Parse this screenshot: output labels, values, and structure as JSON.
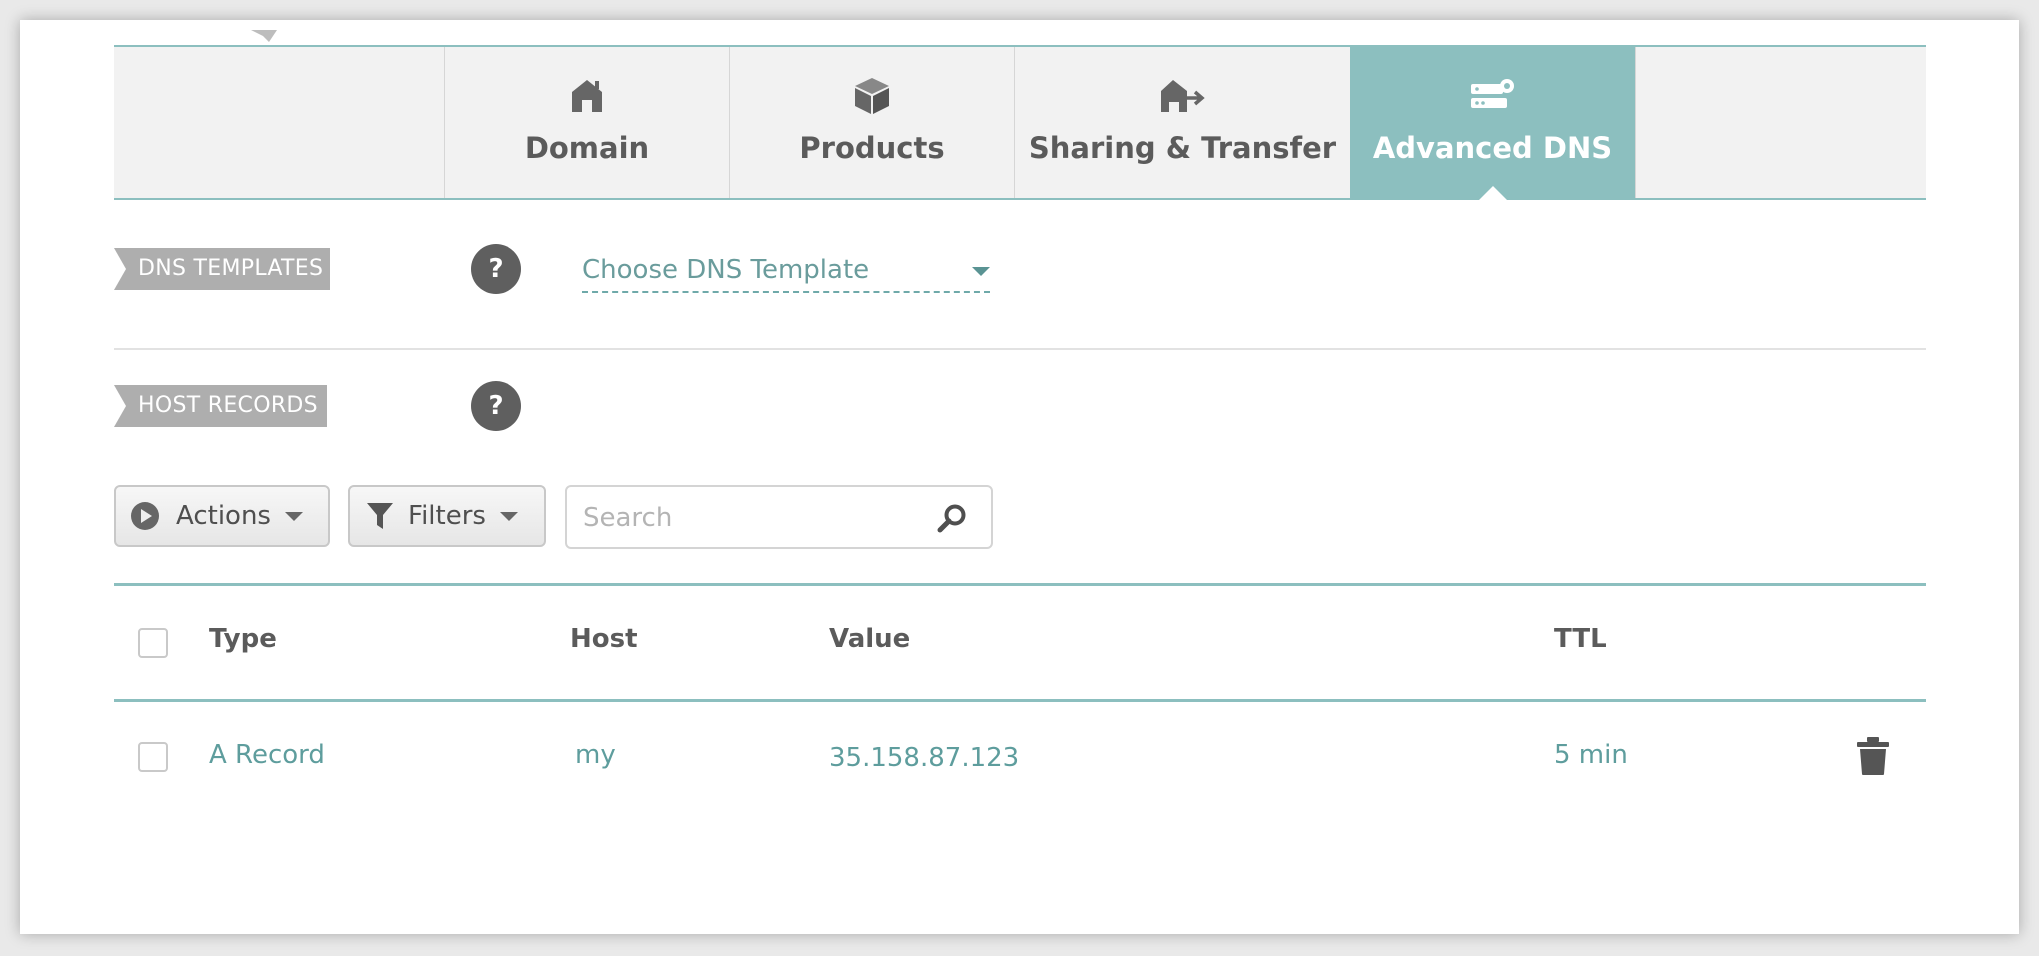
{
  "tabs": [
    {
      "label": "Domain",
      "icon": "house-icon",
      "active": false
    },
    {
      "label": "Products",
      "icon": "box-icon",
      "active": false
    },
    {
      "label": "Sharing & Transfer",
      "icon": "house-transfer-icon",
      "active": false
    },
    {
      "label": "Advanced DNS",
      "icon": "dns-server-icon",
      "active": true
    }
  ],
  "dns_templates": {
    "label": "DNS TEMPLATES",
    "help": "?",
    "select_value": "Choose DNS Template"
  },
  "host_records": {
    "label": "HOST RECORDS",
    "help": "?"
  },
  "toolbar": {
    "actions_label": "Actions",
    "filters_label": "Filters",
    "search_placeholder": "Search"
  },
  "table": {
    "columns": [
      "Type",
      "Host",
      "Value",
      "TTL"
    ],
    "rows": [
      {
        "type": "A Record",
        "host": "my",
        "value": "35.158.87.123",
        "ttl": "5 min"
      }
    ]
  },
  "colors": {
    "accent": "#8cbfbf",
    "link": "#5e9d9d",
    "label_bg": "#aeaeae",
    "help_bg": "#5f5f5f"
  }
}
